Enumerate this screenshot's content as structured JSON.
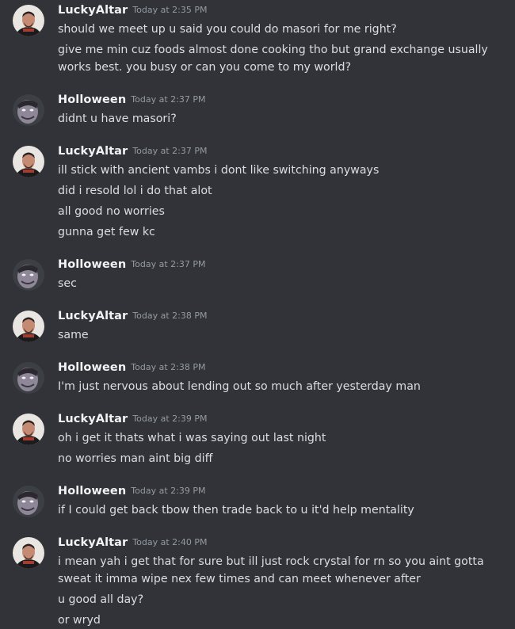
{
  "users": {
    "lucky": {
      "name": "LuckyAltar",
      "avatar_icon": "lucky-avatar-icon"
    },
    "hollo": {
      "name": "Holloween",
      "avatar_icon": "holloween-avatar-icon"
    }
  },
  "messages": [
    {
      "author": "LuckyAltar",
      "time": "Today at 2:35 PM",
      "lines": [
        "should we meet up u said you could do masori for me right?",
        "give me min cuz foods almost done cooking tho but grand exchange usually",
        "works best. you busy or can you come to my world?"
      ]
    },
    {
      "author": "Holloween",
      "time": "Today at 2:37 PM",
      "lines": [
        "didnt u have masori?"
      ]
    },
    {
      "author": "LuckyAltar",
      "time": "Today at 2:37 PM",
      "lines": [
        "ill stick with ancient vambs i dont like switching anyways",
        "did i resold lol i do that alot",
        "all good no worries",
        "gunna get few kc"
      ]
    },
    {
      "author": "Holloween",
      "time": "Today at 2:37 PM",
      "lines": [
        "sec"
      ]
    },
    {
      "author": "LuckyAltar",
      "time": "Today at 2:38 PM",
      "lines": [
        "same"
      ]
    },
    {
      "author": "Holloween",
      "time": "Today at 2:38 PM",
      "lines": [
        "I'm just nervous about lending out so much after yesterday man"
      ]
    },
    {
      "author": "LuckyAltar",
      "time": "Today at 2:39 PM",
      "lines": [
        "oh i get it thats what i was saying out last night",
        "no worries man aint big diff"
      ]
    },
    {
      "author": "Holloween",
      "time": "Today at 2:39 PM",
      "lines": [
        "if I could get back tbow then trade back to u it'd help mentality"
      ]
    },
    {
      "author": "LuckyAltar",
      "time": "Today at 2:40 PM",
      "lines": [
        "i mean yah i get that for sure but ill just rock crystal for rn so you aint gotta",
        "sweat it imma wipe nex few times and can meet whenever after",
        "u good all day?",
        "or wryd"
      ]
    }
  ]
}
